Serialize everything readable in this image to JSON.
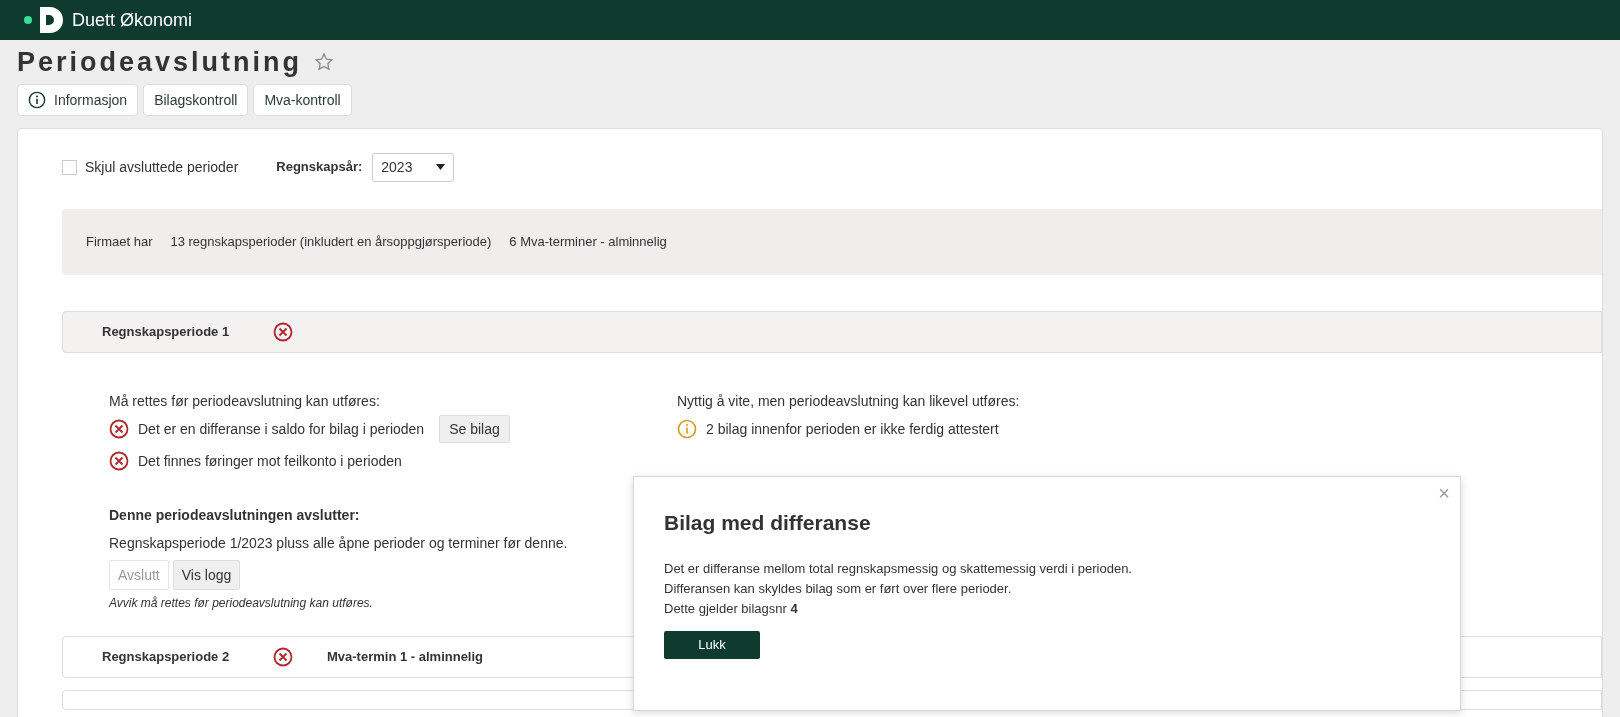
{
  "app_name": "Duett Økonomi",
  "page": {
    "title": "Periodeavslutning"
  },
  "toolbar": [
    {
      "kind": "info",
      "label": "Informasjon"
    },
    {
      "kind": "plain",
      "label": "Bilagskontroll"
    },
    {
      "kind": "plain",
      "label": "Mva-kontroll"
    }
  ],
  "filters": {
    "hide_closed": {
      "label": "Skjul avsluttede perioder",
      "checked": false
    },
    "year": {
      "label": "Regnskapsår:",
      "value": "2023"
    }
  },
  "summary": {
    "label": "Firmaet har",
    "items": [
      "13 regnskapsperioder (inkludert en årsoppgjørsperiode)",
      "6 Mva-terminer - alminnelig"
    ]
  },
  "periods": [
    {
      "title": "Regnskapsperiode 1",
      "kind": "error",
      "expanded": true,
      "details": {
        "must_fix": {
          "heading": "Må rettes før periodeavslutning kan utføres:",
          "items": [
            {
              "kind": "error",
              "text": "Det er en differanse i saldo for bilag i perioden",
              "action": "Se bilag"
            },
            {
              "kind": "error",
              "text": "Det finnes føringer mot feilkonto i perioden"
            }
          ]
        },
        "good_to_know": {
          "heading": "Nyttig å vite, men periodeavslutning kan likevel utføres:",
          "items": [
            {
              "kind": "info",
              "text": "2 bilag innenfor perioden er ikke ferdig attestert"
            }
          ]
        },
        "closes": {
          "heading": "Denne periodeavslutningen avslutter:",
          "text": "Regnskapsperiode 1/2023 pluss alle åpne perioder og terminer før denne.",
          "buttons": [
            {
              "label": "Avslutt",
              "disabled": true
            },
            {
              "label": "Vis logg",
              "disabled": false
            }
          ],
          "note": "Avvik må rettes før periodeavslutning kan utføres."
        }
      }
    },
    {
      "title": "Regnskapsperiode 2",
      "kind": "error",
      "term": "Mva-termin 1 - alminnelig",
      "expanded": false
    }
  ],
  "dialog": {
    "close": "×",
    "title": "Bilag med differanse",
    "lines": [
      "Det er differanse mellom total regnskapsmessig og skattemessig verdi i perioden.",
      "Differansen kan skyldes bilag som er ført over flere perioder.",
      "Dette gjelder bilagsnr **4**"
    ],
    "button": "Lukk"
  }
}
